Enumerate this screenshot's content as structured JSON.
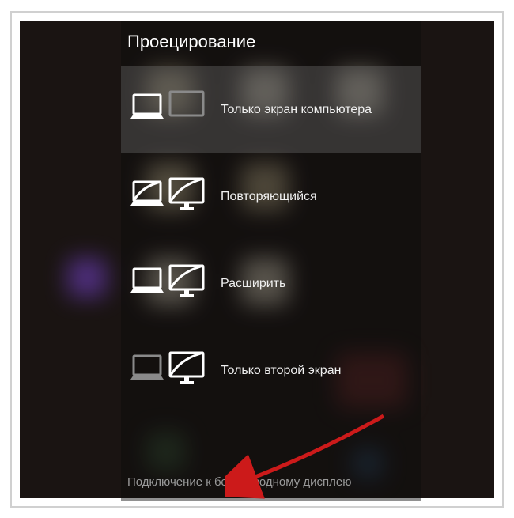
{
  "panel": {
    "title": "Проецирование",
    "options": [
      {
        "label": "Только экран компьютера"
      },
      {
        "label": "Повторяющийся"
      },
      {
        "label": "Расширить"
      },
      {
        "label": "Только второй экран"
      }
    ],
    "footer": "Подключение к беспроводному дисплею"
  }
}
